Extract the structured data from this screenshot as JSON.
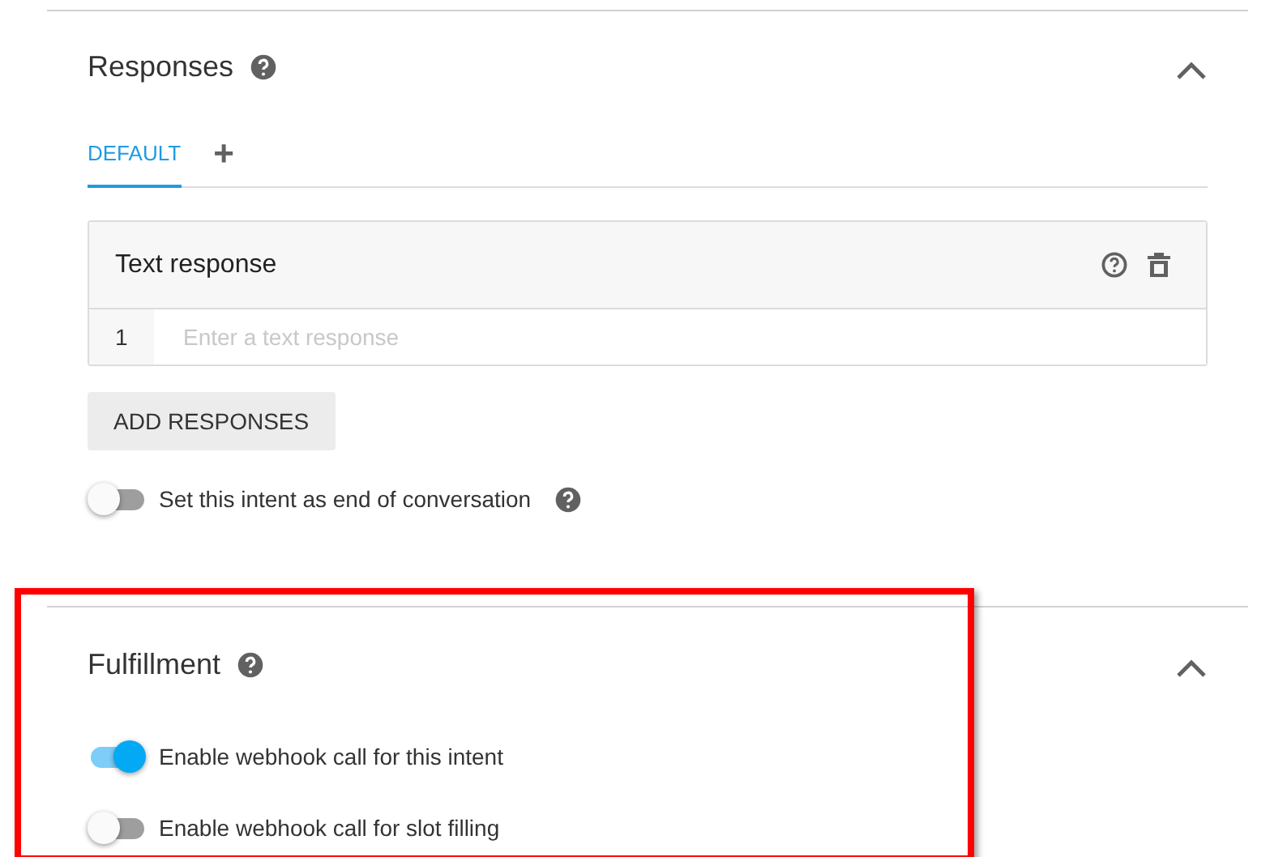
{
  "responses": {
    "title": "Responses",
    "expanded": true,
    "tabs": [
      {
        "label": "DEFAULT",
        "selected": true
      }
    ],
    "add_tab": "+",
    "card": {
      "title": "Text response",
      "rows": [
        {
          "number": "1",
          "placeholder": "Enter a text response"
        }
      ]
    },
    "add_button": "ADD RESPONSES",
    "toggles": [
      {
        "label": "Set this intent as end of conversation",
        "on": false,
        "help": true
      }
    ]
  },
  "fulfillment": {
    "title": "Fulfillment",
    "expanded": true,
    "highlighted": true,
    "toggles": [
      {
        "label": "Enable webhook call for this intent",
        "on": true
      },
      {
        "label": "Enable webhook call for slot filling",
        "on": false
      }
    ]
  }
}
